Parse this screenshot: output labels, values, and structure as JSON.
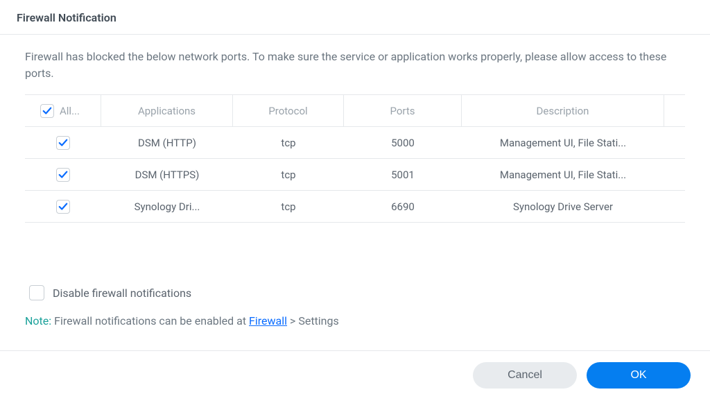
{
  "title": "Firewall Notification",
  "intro": "Firewall has blocked the below network ports. To make sure the service or application works properly, please allow access to these ports.",
  "table": {
    "allow_header": "All...",
    "headers": {
      "applications": "Applications",
      "protocol": "Protocol",
      "ports": "Ports",
      "description": "Description"
    },
    "rows": [
      {
        "checked": true,
        "application": "DSM (HTTP)",
        "protocol": "tcp",
        "ports": "5000",
        "description": "Management UI, File Stati..."
      },
      {
        "checked": true,
        "application": "DSM (HTTPS)",
        "protocol": "tcp",
        "ports": "5001",
        "description": "Management UI, File Stati..."
      },
      {
        "checked": true,
        "application": "Synology Dri...",
        "protocol": "tcp",
        "ports": "6690",
        "description": "Synology Drive Server"
      }
    ]
  },
  "disable_label": "Disable firewall notifications",
  "note": {
    "prefix": "Note:",
    "text1": " Firewall notifications can be enabled at ",
    "link": "Firewall",
    "text2": " > Settings"
  },
  "buttons": {
    "cancel": "Cancel",
    "ok": "OK"
  }
}
